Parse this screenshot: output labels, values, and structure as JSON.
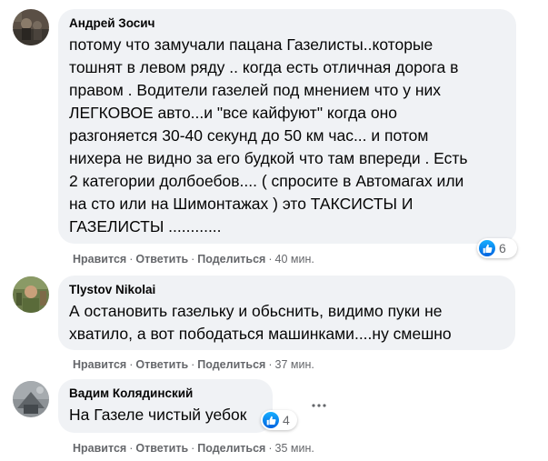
{
  "comments": [
    {
      "author": "Андрей Зосич",
      "lines": [
        "потому что замучали пацана Газелисты..которые",
        "тошнят в левом ряду .. когда есть отличная дорога в",
        "правом . Водители газелей под мнением что у них",
        "ЛЕГКОВОЕ авто...и \"все кайфуют\" когда оно",
        "разгоняется 30-40 секунд до 50 км час... и потом",
        "нихера не видно за его будкой что там впереди . Есть",
        "2 категории долбоебов.... ( спросите в Автомагах или",
        "на сто или на Шимонтажах ) это ТАКСИСТЫ И",
        "ГАЗЕЛИСТЫ ............"
      ],
      "like_label": "Нравится",
      "reply_label": "Ответить",
      "share_label": "Поделиться",
      "time": "40 мин.",
      "reactions": "6",
      "reaction_icon": "thumbs-up-icon"
    },
    {
      "author": "Tlystov Nikolai",
      "lines": [
        "А остановить газельку и обьснить, видимо пуки не",
        "хватило, а вот пободаться машинками....ну смешно"
      ],
      "like_label": "Нравится",
      "reply_label": "Ответить",
      "share_label": "Поделиться",
      "time": "37 мин."
    },
    {
      "author": "Вадим Колядинский",
      "lines": [
        "На Газеле чистый уебок"
      ],
      "like_label": "Нравится",
      "reply_label": "Ответить",
      "share_label": "Поделиться",
      "time": "35 мин.",
      "reactions": "4",
      "reaction_icon": "thumbs-up-icon",
      "more_icon": "more-options-icon"
    }
  ],
  "separator": "·",
  "colors": {
    "bubble_bg": "#f0f2f5",
    "meta_text": "#65676b",
    "like_blue": "#1877f2"
  }
}
